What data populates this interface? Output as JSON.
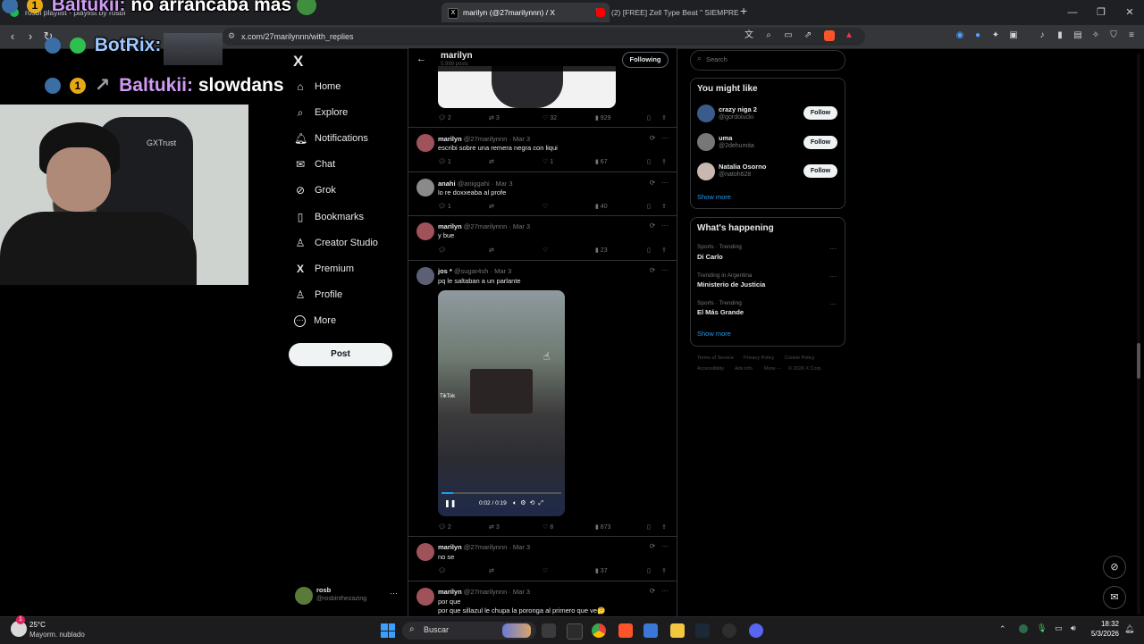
{
  "browser": {
    "tabs": [
      {
        "label": "rosbi playlist - playlist by rosbi",
        "color": "#1db954"
      },
      {
        "label": "marilyn (@27marilynnn) / X",
        "color": "#000000"
      },
      {
        "label": "(2) [FREE] Zell Type Beat \" SIEMPRE",
        "color": "#ff0000"
      }
    ],
    "new_tab": "+",
    "url": "x.com/27marilynnn/with_replies"
  },
  "overlay": {
    "chat": [
      {
        "user": "Baltukii:",
        "message": "no arrancaba mas"
      },
      {
        "user": "BotRix:",
        "message": ""
      },
      {
        "user": "Baltukii:",
        "message": "slowdans"
      }
    ],
    "badge_number": "1",
    "webcam_brand": "GXTrust"
  },
  "sidebar": {
    "logo": "X",
    "items": [
      {
        "label": "Home",
        "icon": "home-icon",
        "glyph": "⌂"
      },
      {
        "label": "Explore",
        "icon": "search-icon",
        "glyph": "⌕"
      },
      {
        "label": "Notifications",
        "icon": "bell-icon",
        "glyph": "♫"
      },
      {
        "label": "Chat",
        "icon": "mail-icon",
        "glyph": "✉"
      },
      {
        "label": "Grok",
        "icon": "grok-icon",
        "glyph": "⊘"
      },
      {
        "label": "Bookmarks",
        "icon": "bookmark-icon",
        "glyph": "▯"
      },
      {
        "label": "Creator Studio",
        "icon": "creator-icon",
        "glyph": "♙"
      },
      {
        "label": "Premium",
        "icon": "x-premium-icon",
        "glyph": "X"
      },
      {
        "label": "Profile",
        "icon": "profile-icon",
        "glyph": "♙"
      },
      {
        "label": "More",
        "icon": "more-icon",
        "glyph": "⋯"
      }
    ],
    "post_label": "Post",
    "account": {
      "name": "rosb",
      "handle": "@rosbinthezazing",
      "more": "···"
    }
  },
  "timeline": {
    "header_name": "marilyn",
    "header_sub": "5,999 posts",
    "following_label": "Following",
    "first_actions": {
      "replies": "2",
      "retweets": "3",
      "likes": "32",
      "views": "929"
    },
    "tweets": [
      {
        "name": "marilyn",
        "handle": "@27marilynnn",
        "date": "· Mar 3",
        "text": "escribi sobre una remera negra con liqui",
        "replies": "1",
        "retweets": "",
        "likes": "1",
        "views": "67",
        "avatar": "#a0525a"
      },
      {
        "name": "anahi",
        "handle": "@aniggahi",
        "date": "· Mar 3",
        "text": "lo re doxxeaba al profe",
        "replies": "1",
        "retweets": "",
        "likes": "",
        "views": "40",
        "avatar": "#8a8a8a"
      },
      {
        "name": "marilyn",
        "handle": "@27marilynnn",
        "date": "· Mar 3",
        "text": "y bue",
        "replies": "",
        "retweets": "",
        "likes": "",
        "views": "23",
        "avatar": "#a0525a"
      },
      {
        "name": "jos *",
        "handle": "@sugar4sh",
        "date": "· Mar 3",
        "text": "pq le saltaban a un parlante",
        "replies": "2",
        "retweets": "3",
        "likes": "8",
        "views": "873",
        "avatar": "#5c6075"
      },
      {
        "name": "marilyn",
        "handle": "@27marilynnn",
        "date": "· Mar 3",
        "text": "no se",
        "replies": "",
        "retweets": "",
        "likes": "",
        "views": "37",
        "avatar": "#a0525a"
      },
      {
        "name": "marilyn",
        "handle": "@27marilynnn",
        "date": "· Mar 3",
        "text": "por que",
        "text2": "por que sillazul le chupa la poronga al primero que ve🤔",
        "replies": "",
        "retweets": "",
        "likes": "",
        "views": "",
        "avatar": "#a0525a"
      }
    ],
    "video": {
      "time": "0:02 / 0:19",
      "watermark": "TikTok",
      "progress": 0.1
    }
  },
  "right": {
    "search_placeholder": "Search",
    "who_to_follow_title": "You might like",
    "suggestions": [
      {
        "name": "crazy niga 2",
        "handle": "@gordolucki",
        "avatar": "#3b5b8a"
      },
      {
        "name": "uma",
        "handle": "@2dehumita",
        "avatar": "#777777"
      },
      {
        "name": "Natalia Osorno",
        "handle": "@natoh628",
        "avatar": "#c9b8b0"
      }
    ],
    "follow_label": "Follow",
    "show_more": "Show more",
    "happening_title": "What's happening",
    "trends": [
      {
        "category": "Sports · Trending",
        "name": "Di Carlo"
      },
      {
        "category": "Trending in Argentina",
        "name": "Ministerio de Justicia"
      },
      {
        "category": "Sports · Trending",
        "name": "El Más Grande"
      }
    ],
    "show_more2": "Show more",
    "footer1": [
      "Terms of Service",
      "Privacy Policy",
      "Cookie Policy"
    ],
    "footer2": [
      "Accessibility",
      "Ads info",
      "More ···",
      "© 2026 X Corp."
    ]
  },
  "taskbar": {
    "weather_temp": "25°C",
    "weather_desc": "Mayorm. nublado",
    "search_label": "Buscar",
    "time": "18:32",
    "date": "5/3/2026",
    "notif_count": "1"
  }
}
